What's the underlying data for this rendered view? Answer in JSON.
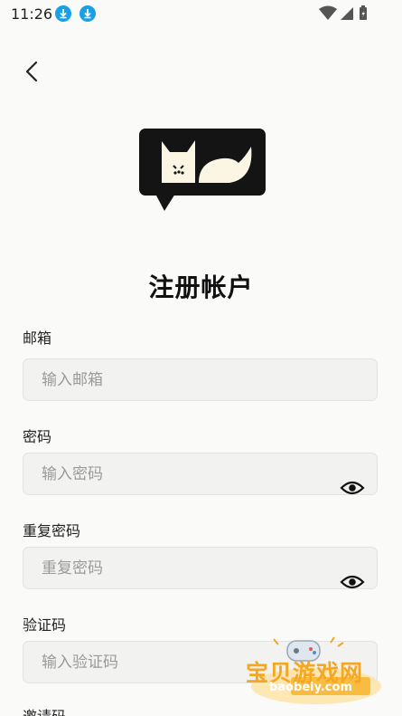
{
  "status_bar": {
    "time": "11:26",
    "icons": [
      "download-icon",
      "download-icon",
      "wifi-icon",
      "signal-icon",
      "battery-icon"
    ]
  },
  "header": {
    "back_icon": "chevron-left-icon"
  },
  "logo": {
    "icon": "cat-chat-bubble-logo"
  },
  "title": "注册帐户",
  "form": {
    "email": {
      "label": "邮箱",
      "placeholder": "输入邮箱"
    },
    "password": {
      "label": "密码",
      "placeholder": "输入密码",
      "toggle_icon": "eye-icon"
    },
    "confirm_password": {
      "label": "重复密码",
      "placeholder": "重复密码",
      "toggle_icon": "eye-icon"
    },
    "code": {
      "label": "验证码",
      "placeholder": "输入验证码"
    },
    "invite": {
      "label": "邀请码"
    }
  },
  "watermark": {
    "text": "宝贝游戏网",
    "sub": "baobeiy.com"
  },
  "colors": {
    "download_badge": "#18a0e6",
    "background": "#fafaf9",
    "field_bg": "#f2f2f1",
    "logo_bg": "#141414",
    "logo_fg": "#fbf6e4",
    "watermark": "#f5a623"
  }
}
